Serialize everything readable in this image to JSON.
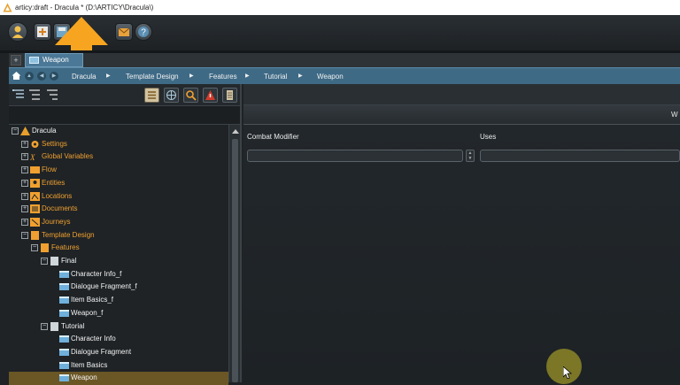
{
  "window": {
    "title": "articy:draft - Dracula * (D:\\ARTICY\\Dracula\\)"
  },
  "tab": {
    "label": "Weapon",
    "add_symbol": "+"
  },
  "breadcrumb": {
    "items": [
      "Dracula",
      "Template Design",
      "Features",
      "Tutorial",
      "Weapon"
    ],
    "separator": "▶"
  },
  "tree": {
    "items": [
      {
        "label": "Dracula",
        "color": "white",
        "icon": "articy-logo-icon",
        "expander": "−"
      },
      {
        "label": "Settings",
        "color": "orange",
        "icon": "gear-icon",
        "expander": "+"
      },
      {
        "label": "Global Variables",
        "color": "orange",
        "icon": "variables-icon",
        "expander": "+"
      },
      {
        "label": "Flow",
        "color": "orange",
        "icon": "flow-icon",
        "expander": "+"
      },
      {
        "label": "Entities",
        "color": "orange",
        "icon": "entities-icon",
        "expander": "+"
      },
      {
        "label": "Locations",
        "color": "orange",
        "icon": "locations-icon",
        "expander": "+"
      },
      {
        "label": "Documents",
        "color": "orange",
        "icon": "documents-icon",
        "expander": "+"
      },
      {
        "label": "Journeys",
        "color": "orange",
        "icon": "journeys-icon",
        "expander": "+"
      },
      {
        "label": "Template Design",
        "color": "orange",
        "icon": "template-design-icon",
        "expander": "−"
      },
      {
        "label": "Features",
        "color": "orange",
        "icon": "features-folder-icon",
        "expander": "−"
      },
      {
        "label": "Final",
        "color": "white",
        "icon": "folder-icon",
        "expander": "−"
      },
      {
        "label": "Character Info_f",
        "color": "white",
        "icon": "feature-icon"
      },
      {
        "label": "Dialogue Fragment_f",
        "color": "white",
        "icon": "feature-icon"
      },
      {
        "label": "Item Basics_f",
        "color": "white",
        "icon": "feature-icon"
      },
      {
        "label": "Weapon_f",
        "color": "white",
        "icon": "feature-icon"
      },
      {
        "label": "Tutorial",
        "color": "white",
        "icon": "folder-icon",
        "expander": "−"
      },
      {
        "label": "Character Info",
        "color": "white",
        "icon": "feature-icon"
      },
      {
        "label": "Dialogue Fragment",
        "color": "white",
        "icon": "feature-icon"
      },
      {
        "label": "Item Basics",
        "color": "white",
        "icon": "feature-icon"
      },
      {
        "label": "Weapon",
        "color": "white",
        "icon": "feature-icon",
        "selected": true
      }
    ]
  },
  "editor": {
    "header_cut": "W",
    "fields": [
      {
        "label": "Combat Modifier",
        "value": ""
      },
      {
        "label": "Uses",
        "value": ""
      }
    ],
    "spin_up": "▲",
    "spin_down": "▼"
  },
  "colors": {
    "orange_text": "#f0a030",
    "selection": "#6b5726",
    "nav_bar": "#3e6a86",
    "arrow": "#f7a520"
  }
}
